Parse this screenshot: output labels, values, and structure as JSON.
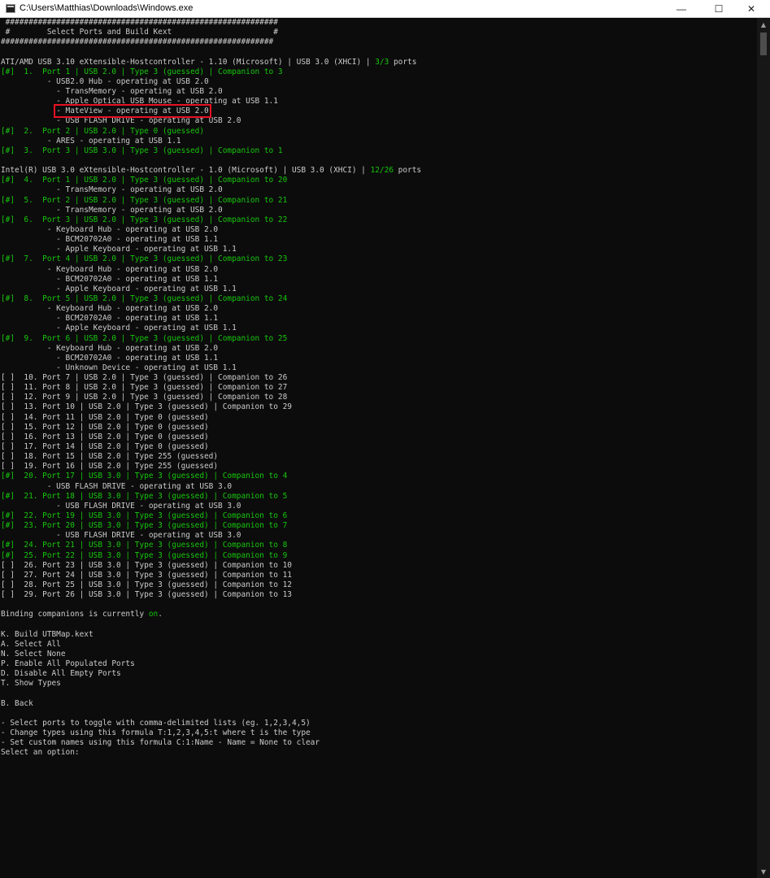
{
  "window": {
    "title": "C:\\Users\\Matthias\\Downloads\\Windows.exe",
    "minimize": "—",
    "maximize": "☐",
    "close": "✕"
  },
  "colors": {
    "background": "#0c0c0c",
    "text": "#cccccc",
    "green": "#16c60c",
    "highlight_box": "#e81123"
  },
  "header": [
    " ###########################################################",
    " #        Select Ports and Build Kext                      #",
    "###########################################################"
  ],
  "controllers": [
    {
      "title_prefix": "ATI/AMD USB 3.10 eXtensible-Hostcontroller - 1.10 (Microsoft) | USB 3.0 (XHCI) | ",
      "count": "3/3",
      "title_suffix": " ports",
      "lines": [
        {
          "g": true,
          "t": "[#]  1.  Port 1 | USB 2.0 | Type 3 (guessed) | Companion to 3"
        },
        {
          "g": false,
          "t": "          - USB2.0 Hub - operating at USB 2.0"
        },
        {
          "g": false,
          "t": "            - TransMemory - operating at USB 2.0"
        },
        {
          "g": false,
          "t": "            - Apple Optical USB Mouse - operating at USB 1.1"
        },
        {
          "g": false,
          "t": "            - MateView - operating at USB 2.0",
          "highlight": true
        },
        {
          "g": false,
          "t": "            - USB FLASH DRIVE - operating at USB 2.0"
        },
        {
          "g": true,
          "t": "[#]  2.  Port 2 | USB 2.0 | Type 0 (guessed)"
        },
        {
          "g": false,
          "t": "          - ARES - operating at USB 1.1"
        },
        {
          "g": true,
          "t": "[#]  3.  Port 3 | USB 3.0 | Type 3 (guessed) | Companion to 1"
        }
      ]
    },
    {
      "title_prefix": "Intel(R) USB 3.0 eXtensible-Hostcontroller - 1.0 (Microsoft) | USB 3.0 (XHCI) | ",
      "count": "12/26",
      "title_suffix": " ports",
      "lines": [
        {
          "g": true,
          "t": "[#]  4.  Port 1 | USB 2.0 | Type 3 (guessed) | Companion to 20"
        },
        {
          "g": false,
          "t": "            - TransMemory - operating at USB 2.0"
        },
        {
          "g": true,
          "t": "[#]  5.  Port 2 | USB 2.0 | Type 3 (guessed) | Companion to 21"
        },
        {
          "g": false,
          "t": "            - TransMemory - operating at USB 2.0"
        },
        {
          "g": true,
          "t": "[#]  6.  Port 3 | USB 2.0 | Type 3 (guessed) | Companion to 22"
        },
        {
          "g": false,
          "t": "          - Keyboard Hub - operating at USB 2.0"
        },
        {
          "g": false,
          "t": "            - BCM20702A0 - operating at USB 1.1"
        },
        {
          "g": false,
          "t": "            - Apple Keyboard - operating at USB 1.1"
        },
        {
          "g": true,
          "t": "[#]  7.  Port 4 | USB 2.0 | Type 3 (guessed) | Companion to 23"
        },
        {
          "g": false,
          "t": "          - Keyboard Hub - operating at USB 2.0"
        },
        {
          "g": false,
          "t": "            - BCM20702A0 - operating at USB 1.1"
        },
        {
          "g": false,
          "t": "            - Apple Keyboard - operating at USB 1.1"
        },
        {
          "g": true,
          "t": "[#]  8.  Port 5 | USB 2.0 | Type 3 (guessed) | Companion to 24"
        },
        {
          "g": false,
          "t": "          - Keyboard Hub - operating at USB 2.0"
        },
        {
          "g": false,
          "t": "            - BCM20702A0 - operating at USB 1.1"
        },
        {
          "g": false,
          "t": "            - Apple Keyboard - operating at USB 1.1"
        },
        {
          "g": true,
          "t": "[#]  9.  Port 6 | USB 2.0 | Type 3 (guessed) | Companion to 25"
        },
        {
          "g": false,
          "t": "          - Keyboard Hub - operating at USB 2.0"
        },
        {
          "g": false,
          "t": "            - BCM20702A0 - operating at USB 1.1"
        },
        {
          "g": false,
          "t": "            - Unknown Device - operating at USB 1.1"
        },
        {
          "g": false,
          "t": "[ ]  10. Port 7 | USB 2.0 | Type 3 (guessed) | Companion to 26"
        },
        {
          "g": false,
          "t": "[ ]  11. Port 8 | USB 2.0 | Type 3 (guessed) | Companion to 27"
        },
        {
          "g": false,
          "t": "[ ]  12. Port 9 | USB 2.0 | Type 3 (guessed) | Companion to 28"
        },
        {
          "g": false,
          "t": "[ ]  13. Port 10 | USB 2.0 | Type 3 (guessed) | Companion to 29"
        },
        {
          "g": false,
          "t": "[ ]  14. Port 11 | USB 2.0 | Type 0 (guessed)"
        },
        {
          "g": false,
          "t": "[ ]  15. Port 12 | USB 2.0 | Type 0 (guessed)"
        },
        {
          "g": false,
          "t": "[ ]  16. Port 13 | USB 2.0 | Type 0 (guessed)"
        },
        {
          "g": false,
          "t": "[ ]  17. Port 14 | USB 2.0 | Type 0 (guessed)"
        },
        {
          "g": false,
          "t": "[ ]  18. Port 15 | USB 2.0 | Type 255 (guessed)"
        },
        {
          "g": false,
          "t": "[ ]  19. Port 16 | USB 2.0 | Type 255 (guessed)"
        },
        {
          "g": true,
          "t": "[#]  20. Port 17 | USB 3.0 | Type 3 (guessed) | Companion to 4"
        },
        {
          "g": false,
          "t": "          - USB FLASH DRIVE - operating at USB 3.0"
        },
        {
          "g": true,
          "t": "[#]  21. Port 18 | USB 3.0 | Type 3 (guessed) | Companion to 5"
        },
        {
          "g": false,
          "t": "            - USB FLASH DRIVE - operating at USB 3.0"
        },
        {
          "g": true,
          "t": "[#]  22. Port 19 | USB 3.0 | Type 3 (guessed) | Companion to 6"
        },
        {
          "g": true,
          "t": "[#]  23. Port 20 | USB 3.0 | Type 3 (guessed) | Companion to 7"
        },
        {
          "g": false,
          "t": "            - USB FLASH DRIVE - operating at USB 3.0"
        },
        {
          "g": true,
          "t": "[#]  24. Port 21 | USB 3.0 | Type 3 (guessed) | Companion to 8"
        },
        {
          "g": true,
          "t": "[#]  25. Port 22 | USB 3.0 | Type 3 (guessed) | Companion to 9"
        },
        {
          "g": false,
          "t": "[ ]  26. Port 23 | USB 3.0 | Type 3 (guessed) | Companion to 10"
        },
        {
          "g": false,
          "t": "[ ]  27. Port 24 | USB 3.0 | Type 3 (guessed) | Companion to 11"
        },
        {
          "g": false,
          "t": "[ ]  28. Port 25 | USB 3.0 | Type 3 (guessed) | Companion to 12"
        },
        {
          "g": false,
          "t": "[ ]  29. Port 26 | USB 3.0 | Type 3 (guessed) | Companion to 13"
        }
      ]
    }
  ],
  "binding": {
    "prefix": "Binding companions is currently ",
    "state": "on",
    "suffix": "."
  },
  "menu": [
    "K. Build UTBMap.kext",
    "A. Select All",
    "N. Select None",
    "P. Enable All Populated Ports",
    "D. Disable All Empty Ports",
    "T. Show Types"
  ],
  "back": "B. Back",
  "help": [
    "- Select ports to toggle with comma-delimited lists (eg. 1,2,3,4,5)",
    "- Change types using this formula T:1,2,3,4,5:t where t is the type",
    "- Set custom names using this formula C:1:Name - Name = None to clear"
  ],
  "prompt": "Select an option:"
}
